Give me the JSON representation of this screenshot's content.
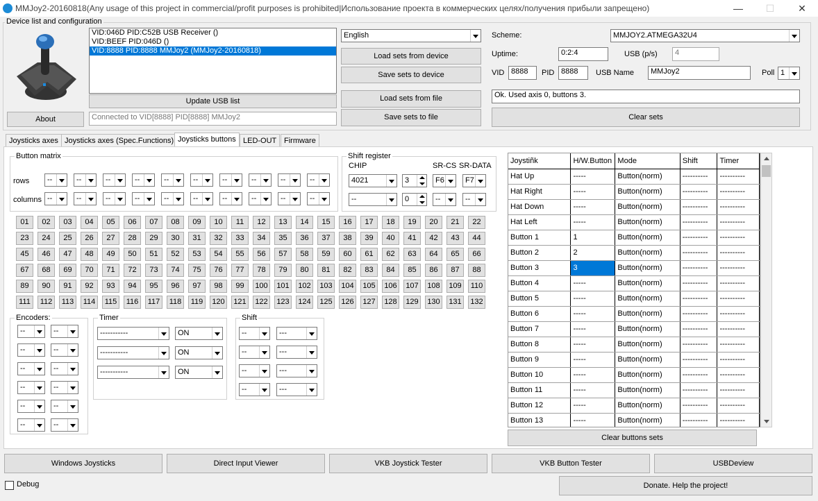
{
  "window": {
    "title": "MMJoy2-20160818(Any usage of this project in commercial/profit purposes is prohibited|Использование проекта в коммерческих целях/получения прибыли запрещено)",
    "minimize": "—",
    "maximize": "☐",
    "close": "✕"
  },
  "device_group": {
    "label": "Device list and configuration"
  },
  "devices": [
    "VID:046D PID:C52B USB Receiver ()",
    "VID:BEEF PID:046D  ()",
    "VID:8888 PID:8888 MMJoy2 (MMJoy2-20160818)"
  ],
  "about_button": "About",
  "update_usb_button": "Update USB list",
  "connection_status": "Connected to VID[8888] PID[8888] MMJoy2",
  "language": "English",
  "load_device_button": "Load sets from device",
  "save_device_button": "Save sets to device",
  "load_file_button": "Load sets from file",
  "save_file_button": "Save sets to file",
  "scheme_label": "Scheme:",
  "scheme_value": "MMJOY2.ATMEGA32U4",
  "uptime_label": "Uptime:",
  "uptime_value": "0:2:4",
  "usb_ps_label": "USB (p/s)",
  "usb_ps_value": "4",
  "vid_label": "VID",
  "vid_value": "8888",
  "pid_label": "PID",
  "pid_value": "8888",
  "usbname_label": "USB Name",
  "usbname_value": "MMJoy2",
  "poll_label": "Poll",
  "poll_value": "1",
  "status_message": "Ok. Used axis  0, buttons 3.",
  "clear_sets_button": "Clear sets",
  "tabs": [
    "Joysticks axes",
    "Joysticks axes (Spec.Functions)",
    "Joysticks buttons",
    "LED-OUT",
    "Firmware"
  ],
  "button_matrix": {
    "label": "Button matrix",
    "rows_label": "rows",
    "columns_label": "columns",
    "placeholder": "--"
  },
  "shift_register": {
    "label": "Shift register",
    "chip_label": "CHIP",
    "srcs_label": "SR-CS",
    "srdata_label": "SR-DATA",
    "chip1": "4021",
    "spin1": "3",
    "srcs1": "F6",
    "srdata1": "F7",
    "chip2": "--",
    "spin2": "0",
    "srcs2": "--",
    "srdata2": "--"
  },
  "buttons_grid": [
    "01",
    "02",
    "03",
    "04",
    "05",
    "06",
    "07",
    "08",
    "09",
    "10",
    "11",
    "12",
    "13",
    "14",
    "15",
    "16",
    "17",
    "18",
    "19",
    "20",
    "21",
    "22",
    "23",
    "24",
    "25",
    "26",
    "27",
    "28",
    "29",
    "30",
    "31",
    "32",
    "33",
    "34",
    "35",
    "36",
    "37",
    "38",
    "39",
    "40",
    "41",
    "42",
    "43",
    "44",
    "45",
    "46",
    "47",
    "48",
    "49",
    "50",
    "51",
    "52",
    "53",
    "54",
    "55",
    "56",
    "57",
    "58",
    "59",
    "60",
    "61",
    "62",
    "63",
    "64",
    "65",
    "66",
    "67",
    "68",
    "69",
    "70",
    "71",
    "72",
    "73",
    "74",
    "75",
    "76",
    "77",
    "78",
    "79",
    "80",
    "81",
    "82",
    "83",
    "84",
    "85",
    "86",
    "87",
    "88",
    "89",
    "90",
    "91",
    "92",
    "93",
    "94",
    "95",
    "96",
    "97",
    "98",
    "99",
    "100",
    "101",
    "102",
    "103",
    "104",
    "105",
    "106",
    "107",
    "108",
    "109",
    "110",
    "111",
    "112",
    "113",
    "114",
    "115",
    "116",
    "117",
    "118",
    "119",
    "120",
    "121",
    "122",
    "123",
    "124",
    "125",
    "126",
    "127",
    "128",
    "129",
    "130",
    "131",
    "132"
  ],
  "encoders": {
    "label": "Encoders:",
    "value": "--"
  },
  "timer": {
    "label": "Timer",
    "value": "-----------",
    "state": "ON"
  },
  "shift": {
    "label": "Shift",
    "left": "--",
    "right": "---"
  },
  "table": {
    "headers": [
      "Joystiñk",
      "H/W.Button",
      "Mode",
      "Shift",
      "Timer"
    ],
    "rows": [
      [
        "Hat Up",
        "-----",
        "Button(norm)",
        "----------",
        "----------"
      ],
      [
        "Hat Right",
        "-----",
        "Button(norm)",
        "----------",
        "----------"
      ],
      [
        "Hat Down",
        "-----",
        "Button(norm)",
        "----------",
        "----------"
      ],
      [
        "Hat Left",
        "-----",
        "Button(norm)",
        "----------",
        "----------"
      ],
      [
        "Button 1",
        "1",
        "Button(norm)",
        "----------",
        "----------"
      ],
      [
        "Button 2",
        "2",
        "Button(norm)",
        "----------",
        "----------"
      ],
      [
        "Button 3",
        "3",
        "Button(norm)",
        "----------",
        "----------"
      ],
      [
        "Button 4",
        "-----",
        "Button(norm)",
        "----------",
        "----------"
      ],
      [
        "Button 5",
        "-----",
        "Button(norm)",
        "----------",
        "----------"
      ],
      [
        "Button 6",
        "-----",
        "Button(norm)",
        "----------",
        "----------"
      ],
      [
        "Button 7",
        "-----",
        "Button(norm)",
        "----------",
        "----------"
      ],
      [
        "Button 8",
        "-----",
        "Button(norm)",
        "----------",
        "----------"
      ],
      [
        "Button 9",
        "-----",
        "Button(norm)",
        "----------",
        "----------"
      ],
      [
        "Button 10",
        "-----",
        "Button(norm)",
        "----------",
        "----------"
      ],
      [
        "Button 11",
        "-----",
        "Button(norm)",
        "----------",
        "----------"
      ],
      [
        "Button 12",
        "-----",
        "Button(norm)",
        "----------",
        "----------"
      ],
      [
        "Button 13",
        "-----",
        "Button(norm)",
        "----------",
        "----------"
      ]
    ]
  },
  "clear_buttons_button": "Clear buttons sets",
  "bottom_buttons": [
    "Windows Joysticks",
    "Direct Input Viewer",
    "VKB Joystick Tester",
    "VKB Button Tester",
    "USBDeview"
  ],
  "debug_label": "Debug",
  "donate_button": "Donate. Help the project!",
  "accent_color": "#0078d7"
}
